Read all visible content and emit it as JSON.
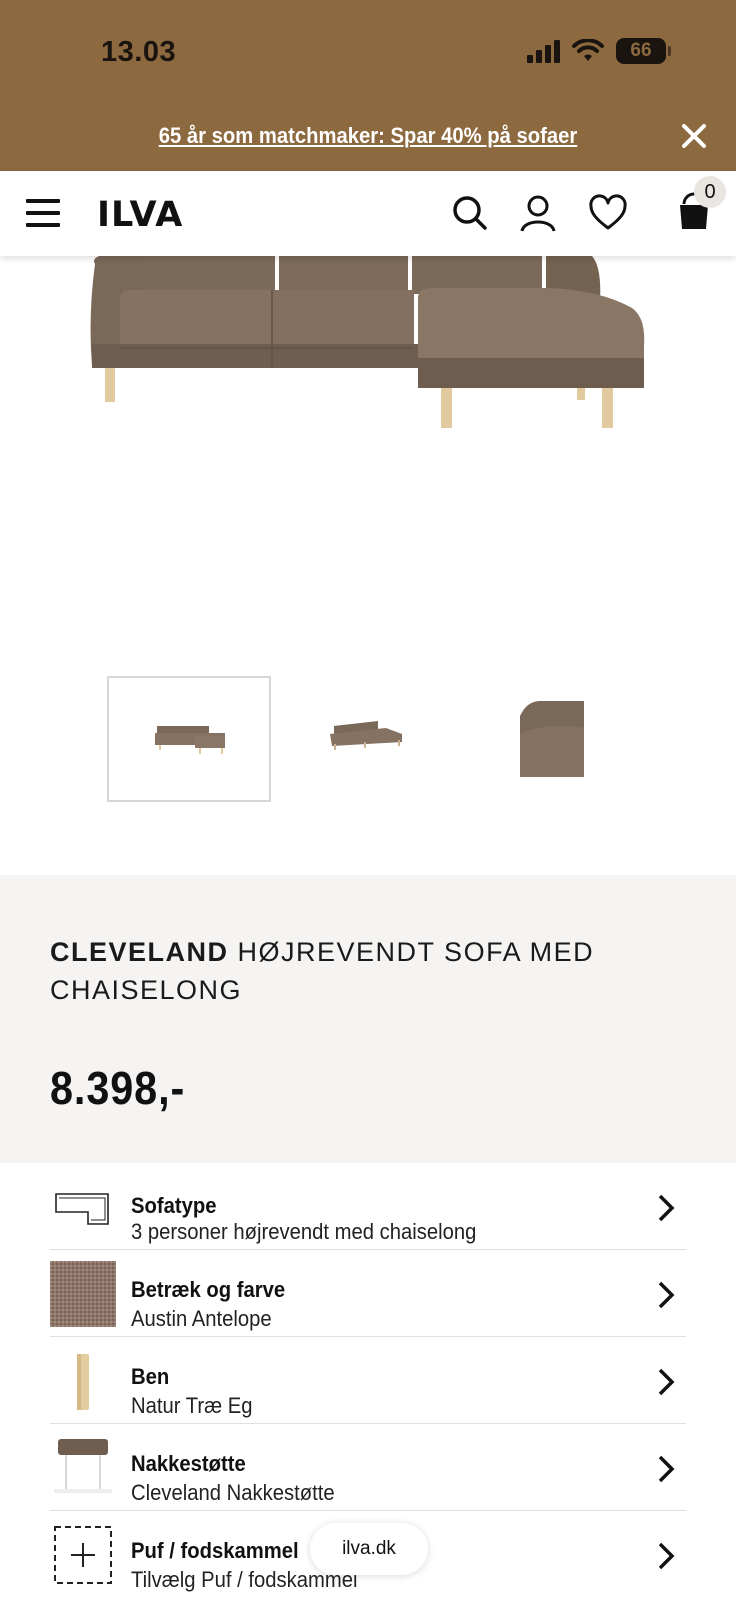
{
  "status_bar": {
    "time": "13.03",
    "battery": "66"
  },
  "promo": {
    "text": "65 år som matchmaker: Spar 40% på sofaer"
  },
  "header": {
    "logo": "ILVA",
    "cart_count": "0"
  },
  "product": {
    "brand": "CLEVELAND",
    "name": "HØJREVENDT SOFA MED CHAISELONG",
    "price": "8.398,-",
    "color_hex": "#7a6858"
  },
  "options": [
    {
      "label": "Sofatype",
      "value": "3 personer højrevendt med chaiselong"
    },
    {
      "label": "Betræk og farve",
      "value": "Austin Antelope"
    },
    {
      "label": "Ben",
      "value": "Natur Træ Eg"
    },
    {
      "label": "Nakkestøtte",
      "value": "Cleveland Nakkestøtte"
    },
    {
      "label": "Puf / fodskammel",
      "value": "Tilvælg Puf / fodskammel"
    }
  ],
  "browser": {
    "url": "ilva.dk"
  },
  "colors": {
    "promo_bg": "#8c693e",
    "info_bg": "#f5f4f2"
  }
}
